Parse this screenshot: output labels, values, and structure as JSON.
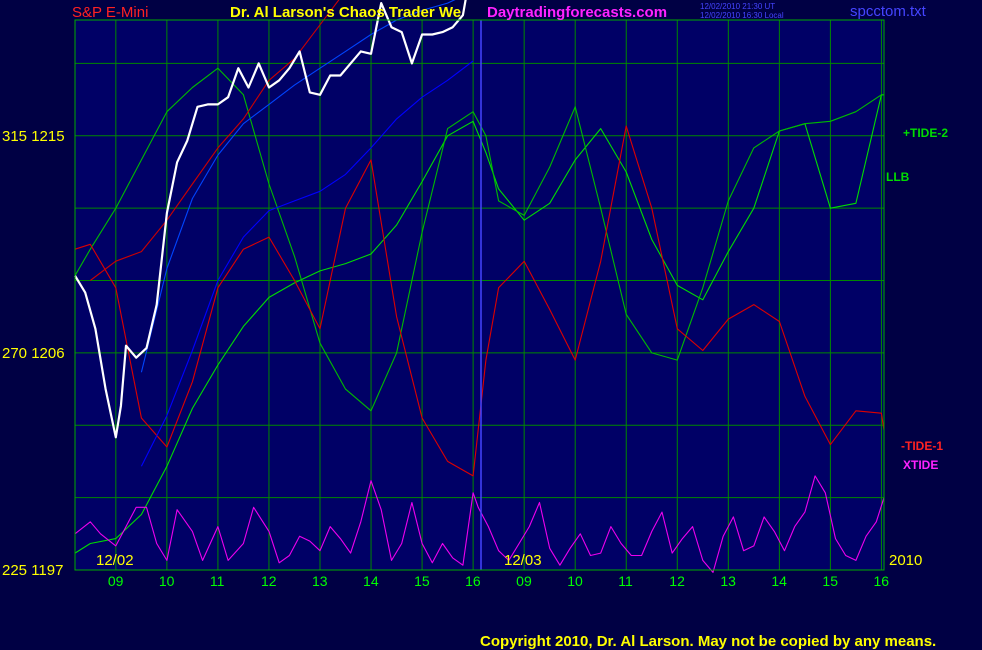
{
  "header": {
    "instrument": "S&P E-Mini",
    "title": "Dr. Al Larson's Chaos Trader We",
    "website": "Daytradingforecasts.com",
    "timestamp_ut": "12/02/2010 21:30 UT",
    "timestamp_local": "12/02/2010 16:30 Local",
    "filename": "spcctom.txt"
  },
  "footer": {
    "copyright": "Copyright 2010, Dr. Al Larson. May not be copied by any means."
  },
  "colors": {
    "background": "#000044",
    "plot_background": "#000066",
    "grid": "#008800",
    "price": "#ffffff",
    "tide2": "#00dd00",
    "llb": "#00bb00",
    "tide1": "#dd0000",
    "xtide": "#ee00ee",
    "envelope_mid": "#0000ff",
    "date_text": "#ffff00",
    "hour_text": "#00ff00"
  },
  "chart_data": {
    "type": "line",
    "title": "S&P E-Mini",
    "y_axis": {
      "ticks": [
        {
          "value": 1215,
          "label": "315  1215"
        },
        {
          "value": 1206,
          "label": "270  1206"
        },
        {
          "value": 1197,
          "label": "225  1197"
        }
      ],
      "range": [
        1197,
        1219.8
      ]
    },
    "x_axis": {
      "hour_labels": [
        "09",
        "10",
        "11",
        "12",
        "13",
        "14",
        "15",
        "16",
        "09",
        "10",
        "11",
        "12",
        "13",
        "14",
        "15",
        "16"
      ],
      "date_labels": [
        "12/02",
        "12/03"
      ],
      "year_label": "2010",
      "range": [
        8.2,
        24.05
      ]
    },
    "grid": true,
    "series": [
      {
        "name": "+TIDE-2",
        "x": [
          8.2,
          8.5,
          9,
          9.5,
          10,
          10.5,
          11,
          11.5,
          12,
          12.5,
          13,
          13.5,
          14,
          14.5,
          15,
          15.5,
          16,
          16.25,
          16.5,
          17,
          17.5,
          18,
          18.5,
          19,
          19.5,
          20,
          20.5,
          21,
          21.5,
          22,
          22.5,
          23,
          23.5,
          24,
          24.05
        ],
        "y": [
          1197.7,
          1198.1,
          1198.3,
          1199.3,
          1201.3,
          1203.7,
          1205.5,
          1207.1,
          1208.3,
          1208.9,
          1209.4,
          1209.7,
          1210.1,
          1211.3,
          1213.1,
          1215,
          1215.6,
          1214.3,
          1212.8,
          1211.5,
          1212.2,
          1214,
          1215.3,
          1213.5,
          1210.7,
          1208.8,
          1208.2,
          1210.2,
          1212,
          1215.2,
          1215.5,
          1212,
          1212.2,
          1216.7,
          1216.7
        ]
      },
      {
        "name": "LLB",
        "x": [
          8.2,
          8.5,
          9,
          9.5,
          10,
          10.5,
          11,
          11.5,
          12,
          12.5,
          13,
          13.5,
          14,
          14.5,
          15,
          15.5,
          16,
          16.25,
          16.5,
          17,
          17.5,
          18,
          18.5,
          19,
          19.5,
          20,
          20.5,
          21,
          21.5,
          22,
          22.5,
          23,
          23.5,
          24,
          24.05
        ],
        "y": [
          1209.2,
          1210.3,
          1212,
          1214,
          1216,
          1217,
          1217.8,
          1216.7,
          1213,
          1210,
          1206.4,
          1204.5,
          1203.6,
          1206,
          1211,
          1215.3,
          1216,
          1215,
          1212.3,
          1211.7,
          1213.7,
          1216.2,
          1212,
          1207.6,
          1206,
          1205.7,
          1208.7,
          1212.3,
          1214.5,
          1215.2,
          1215.5,
          1215.6,
          1216,
          1216.7,
          1216.7
        ]
      },
      {
        "name": "-TIDE-1",
        "x": [
          8.2,
          8.5,
          9,
          9.5,
          10,
          10.5,
          11,
          11.5,
          12,
          12.5,
          13,
          13.5,
          14,
          14.5,
          15,
          15.5,
          16,
          16.25,
          16.5,
          17,
          17.5,
          18,
          18.5,
          19,
          19.5,
          20,
          20.5,
          21,
          21.5,
          22,
          22.5,
          23,
          23.5,
          24,
          24.05
        ],
        "y": [
          1210.3,
          1210.5,
          1208.7,
          1203.3,
          1202.1,
          1204.8,
          1208.7,
          1210.3,
          1210.8,
          1209,
          1207,
          1212,
          1214,
          1207.5,
          1203.3,
          1201.5,
          1200.9,
          1205.7,
          1208.7,
          1209.8,
          1207.8,
          1205.7,
          1209.8,
          1215.4,
          1212,
          1207,
          1206.1,
          1207.4,
          1208,
          1207.3,
          1204.2,
          1202.2,
          1203.6,
          1203.5,
          1202.8
        ]
      },
      {
        "name": "XTIDE",
        "x": [
          8.2,
          8.5,
          8.7,
          9,
          9.2,
          9.4,
          9.6,
          9.8,
          10,
          10.2,
          10.5,
          10.7,
          11,
          11.2,
          11.5,
          11.7,
          12,
          12.2,
          12.4,
          12.6,
          12.8,
          13,
          13.2,
          13.4,
          13.6,
          13.8,
          14,
          14.2,
          14.4,
          14.6,
          14.8,
          15,
          15.2,
          15.4,
          15.6,
          15.8,
          16,
          16.1,
          16.3,
          16.5,
          16.7,
          16.9,
          17.1,
          17.3,
          17.5,
          17.7,
          17.9,
          18.1,
          18.3,
          18.5,
          18.7,
          18.9,
          19.1,
          19.3,
          19.5,
          19.7,
          19.9,
          20.1,
          20.3,
          20.5,
          20.7,
          20.9,
          21.1,
          21.3,
          21.5,
          21.7,
          21.9,
          22.1,
          22.3,
          22.5,
          22.7,
          22.9,
          23.1,
          23.3,
          23.5,
          23.7,
          23.9,
          24.05
        ],
        "y": [
          1198.5,
          1199,
          1198.5,
          1198,
          1198.8,
          1199.6,
          1199.6,
          1198.1,
          1197.4,
          1199.5,
          1198.6,
          1197.4,
          1198.8,
          1197.4,
          1198.1,
          1199.6,
          1198.6,
          1197.3,
          1197.6,
          1198.4,
          1198.2,
          1197.8,
          1198.8,
          1198.3,
          1197.7,
          1199,
          1200.7,
          1199.5,
          1197.4,
          1198.1,
          1199.8,
          1198.1,
          1197.3,
          1198.1,
          1197.5,
          1197.2,
          1200.2,
          1199.6,
          1198.8,
          1197.8,
          1197.4,
          1198.1,
          1198.8,
          1199.8,
          1197.9,
          1197.2,
          1197.9,
          1198.5,
          1197.6,
          1197.7,
          1198.8,
          1198.1,
          1197.6,
          1197.6,
          1198.6,
          1199.4,
          1197.7,
          1198.3,
          1198.8,
          1197.4,
          1196.9,
          1198.4,
          1199.2,
          1197.8,
          1198,
          1199.2,
          1198.6,
          1197.8,
          1198.8,
          1199.4,
          1200.9,
          1200.2,
          1198.3,
          1197.6,
          1197.4,
          1198.4,
          1199,
          1200
        ]
      },
      {
        "name": "",
        "x": [
          9.5,
          10,
          10.5,
          11,
          11.5,
          12,
          12.5,
          13,
          13.5,
          14,
          14.5,
          15,
          15.5,
          16
        ],
        "y": [
          1201.3,
          1203.4,
          1206.1,
          1209,
          1210.8,
          1211.9,
          1212.3,
          1212.7,
          1213.4,
          1214.5,
          1215.7,
          1216.6,
          1217.3,
          1218.1
        ]
      },
      {
        "name": "",
        "x": [
          9.5,
          10,
          10.5,
          11,
          11.5,
          12,
          12.5,
          13,
          13.5,
          14,
          14.5,
          15,
          15.5,
          16
        ],
        "y": [
          1205.2,
          1209.5,
          1212.4,
          1214.2,
          1215.5,
          1216.3,
          1217.1,
          1217.8,
          1218.5,
          1219.2,
          1219.8,
          1220.2,
          1220.5,
          1221
        ]
      },
      {
        "name": "",
        "x": [
          8.5,
          9,
          9.5,
          10,
          10.5,
          11,
          11.5,
          12,
          12.5,
          13,
          13.5,
          14,
          14.5,
          15,
          15.5,
          16
        ],
        "y": [
          1209,
          1209.8,
          1210.2,
          1211.5,
          1213,
          1214.5,
          1215.7,
          1217.3,
          1218.2,
          1219.6,
          1221,
          1222.5,
          1223.3,
          1224.3,
          1225.5,
          1226.3
        ]
      },
      {
        "name": "price",
        "x": [
          8.2,
          8.4,
          8.6,
          8.8,
          9,
          9.1,
          9.2,
          9.4,
          9.6,
          9.8,
          10,
          10.2,
          10.4,
          10.6,
          10.8,
          11,
          11.2,
          11.4,
          11.6,
          11.8,
          12,
          12.2,
          12.4,
          12.6,
          12.8,
          13,
          13.2,
          13.4,
          13.6,
          13.8,
          14,
          14.2,
          14.4,
          14.6,
          14.8,
          15,
          15.2,
          15.4,
          15.6,
          15.8,
          15.9,
          16,
          16.05
        ],
        "y": [
          1209.2,
          1208.5,
          1207,
          1204.5,
          1202.5,
          1203.8,
          1206.3,
          1205.8,
          1206.2,
          1208,
          1211.8,
          1213.9,
          1214.8,
          1216.2,
          1216.3,
          1216.3,
          1216.6,
          1217.8,
          1217,
          1218,
          1217,
          1217.3,
          1217.8,
          1218.5,
          1216.8,
          1216.7,
          1217.5,
          1217.5,
          1218,
          1218.5,
          1218.4,
          1220.5,
          1219.5,
          1219.3,
          1218,
          1219.2,
          1219.2,
          1219.3,
          1219.5,
          1220,
          1221.2,
          1221.5,
          1222.5
        ]
      }
    ],
    "legend": {
      "tide2": "+TIDE-2",
      "llb": "LLB",
      "tide1": "-TIDE-1",
      "xtide": "XTIDE"
    }
  }
}
